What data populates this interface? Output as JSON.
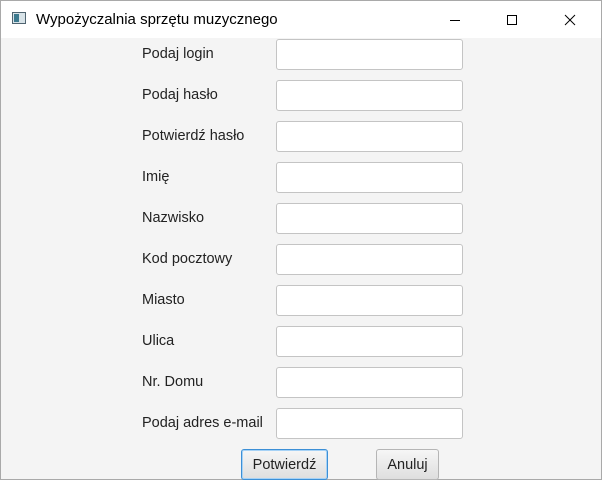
{
  "window": {
    "title": "Wypożyczalnia sprzętu muzycznego",
    "controls": [
      "minimize-icon",
      "maximize-icon",
      "close-icon"
    ]
  },
  "form": {
    "fields": [
      {
        "label": "Podaj login",
        "value": ""
      },
      {
        "label": "Podaj hasło",
        "value": ""
      },
      {
        "label": "Potwierdź hasło",
        "value": ""
      },
      {
        "label": "Imię",
        "value": ""
      },
      {
        "label": "Nazwisko",
        "value": ""
      },
      {
        "label": "Kod pocztowy",
        "value": ""
      },
      {
        "label": "Miasto",
        "value": ""
      },
      {
        "label": "Ulica",
        "value": ""
      },
      {
        "label": "Nr. Domu",
        "value": ""
      },
      {
        "label": "Podaj adres e-mail",
        "value": ""
      }
    ]
  },
  "buttons": {
    "confirm": "Potwierdź",
    "cancel": "Anuluj"
  },
  "colors": {
    "background": "#f4f4f4",
    "titlebar": "#ffffff",
    "focus_border": "#3c8fd6"
  }
}
